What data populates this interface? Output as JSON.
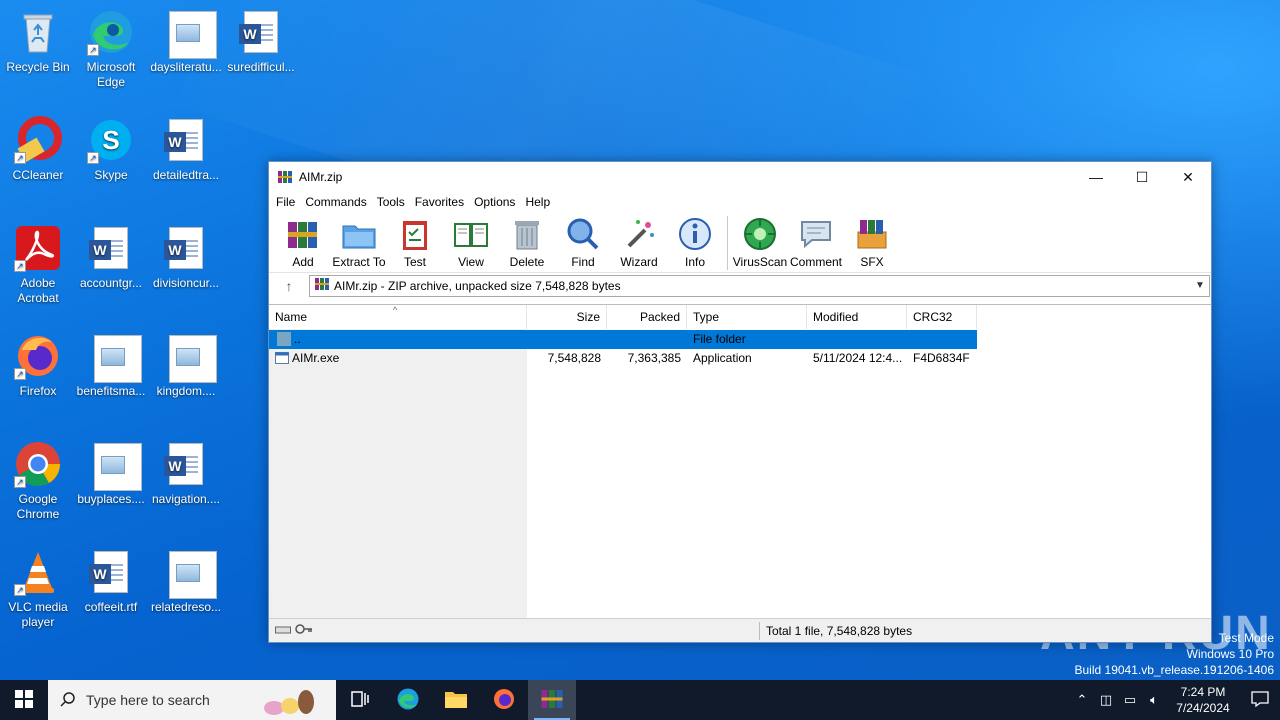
{
  "desktop": {
    "icons": [
      {
        "label": "Recycle Bin",
        "icon": "recycle-bin-icon"
      },
      {
        "label": "Microsoft Edge",
        "icon": "edge-icon"
      },
      {
        "label": "daysliteratu...",
        "icon": "image-file-icon"
      },
      {
        "label": "suredifficul...",
        "icon": "word-doc-icon"
      },
      {
        "label": "CCleaner",
        "icon": "ccleaner-icon"
      },
      {
        "label": "Skype",
        "icon": "skype-icon"
      },
      {
        "label": "detailedtra...",
        "icon": "word-doc-icon"
      },
      {
        "label": "Adobe Acrobat",
        "icon": "acrobat-icon"
      },
      {
        "label": "accountgr...",
        "icon": "word-doc-icon"
      },
      {
        "label": "divisioncur...",
        "icon": "word-doc-icon"
      },
      {
        "label": "Firefox",
        "icon": "firefox-icon"
      },
      {
        "label": "benefitsma...",
        "icon": "image-file-icon"
      },
      {
        "label": "kingdom....",
        "icon": "image-file-icon"
      },
      {
        "label": "Google Chrome",
        "icon": "chrome-icon"
      },
      {
        "label": "buyplaces....",
        "icon": "image-file-icon"
      },
      {
        "label": "navigation....",
        "icon": "word-doc-icon"
      },
      {
        "label": "VLC media player",
        "icon": "vlc-icon"
      },
      {
        "label": "coffeeit.rtf",
        "icon": "word-doc-icon"
      },
      {
        "label": "relatedreso...",
        "icon": "image-file-icon"
      }
    ]
  },
  "window": {
    "title": "AIMr.zip",
    "menu": [
      "File",
      "Commands",
      "Tools",
      "Favorites",
      "Options",
      "Help"
    ],
    "toolbar": [
      {
        "label": "Add",
        "icon": "add-archive-icon"
      },
      {
        "label": "Extract To",
        "icon": "extract-folder-icon"
      },
      {
        "label": "Test",
        "icon": "test-clipboard-icon"
      },
      {
        "label": "View",
        "icon": "view-book-icon"
      },
      {
        "label": "Delete",
        "icon": "trash-icon"
      },
      {
        "label": "Find",
        "icon": "magnifier-icon"
      },
      {
        "label": "Wizard",
        "icon": "wand-icon"
      },
      {
        "label": "Info",
        "icon": "info-icon"
      },
      {
        "label": "VirusScan",
        "icon": "virus-scan-icon"
      },
      {
        "label": "Comment",
        "icon": "comment-icon"
      },
      {
        "label": "SFX",
        "icon": "sfx-icon"
      }
    ],
    "address": "AIMr.zip - ZIP archive, unpacked size 7,548,828 bytes",
    "columns": [
      "Name",
      "Size",
      "Packed",
      "Type",
      "Modified",
      "CRC32"
    ],
    "rows": [
      {
        "name": "..",
        "size": "",
        "packed": "",
        "type": "File folder",
        "modified": "",
        "crc": ""
      },
      {
        "name": "AIMr.exe",
        "size": "7,548,828",
        "packed": "7,363,385",
        "type": "Application",
        "modified": "5/11/2024 12:4...",
        "crc": "F4D6834F"
      }
    ],
    "status": "Total 1 file, 7,548,828 bytes"
  },
  "watermark": {
    "logo": "ANY RUN",
    "lines": [
      "Test Mode",
      "Windows 10 Pro",
      "Build 19041.vb_release.191206-1406"
    ]
  },
  "taskbar": {
    "search_placeholder": "Type here to search",
    "time": "7:24 PM",
    "date": "7/24/2024"
  },
  "colors": {
    "selection": "#0078d7",
    "taskbar": "#101a2a",
    "desktop": "#0b73dc"
  }
}
